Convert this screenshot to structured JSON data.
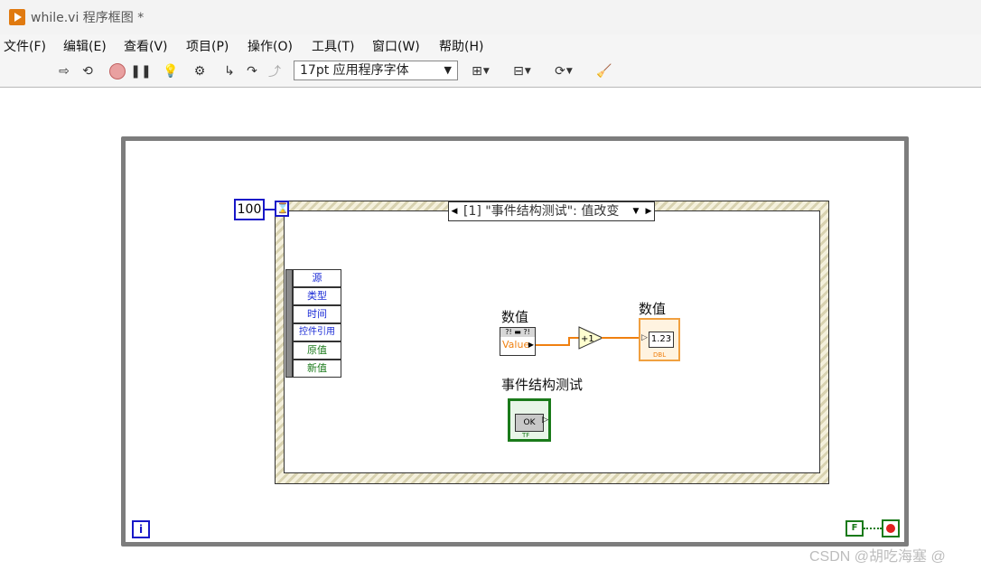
{
  "window": {
    "title": "while.vi 程序框图 *"
  },
  "menu": [
    "文件(F)",
    "编辑(E)",
    "查看(V)",
    "项目(P)",
    "操作(O)",
    "工具(T)",
    "窗口(W)",
    "帮助(H)"
  ],
  "toolbar": {
    "font_label": "17pt 应用程序字体"
  },
  "diagram": {
    "timeout_value": "100",
    "timeout_terminal_glyph": "⌛",
    "event_case": "[1] \"事件结构测试\": 值改变",
    "event_data_fields": [
      "源",
      "类型",
      "时间",
      "控件引用",
      "原值",
      "新值"
    ],
    "num_control_label": "数值",
    "num_control_ref_text": "Value",
    "num_control_ref_top": "?! ▬ ?!",
    "increment_label": "+1",
    "num_indicator_label": "数值",
    "num_indicator_value": "1.23",
    "num_indicator_type": "DBL",
    "bool_control_label": "事件结构测试",
    "bool_button_text": "OK",
    "bool_type": "TF",
    "iteration_glyph": "i",
    "false_constant": "F"
  },
  "watermark": "CSDN @胡吃海塞 @"
}
